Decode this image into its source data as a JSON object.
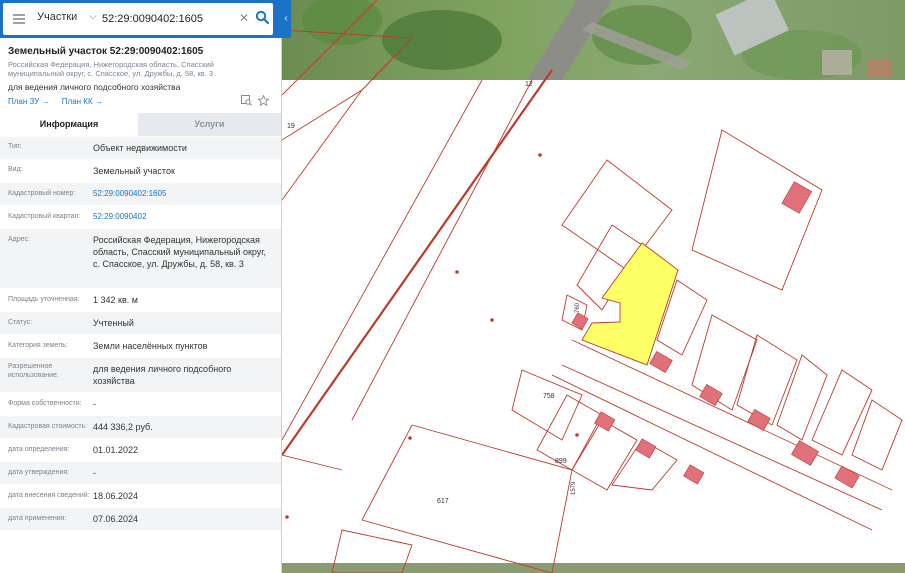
{
  "search": {
    "type_label": "Участки",
    "query": "52:29:0090402:1605"
  },
  "object": {
    "title": "Земельный участок 52:29:0090402:1605",
    "address_short": "Российская Федерация, Нижегородская область, Спасский муниципальный округ, с. Спасское, ул. Дружбы, д. 58, кв. 3",
    "purpose": "для ведения личного подсобного хозяйства",
    "plan_zu": "План ЗУ →",
    "plan_kk": "План КК →"
  },
  "tabs": {
    "info": "Информация",
    "services": "Услуги"
  },
  "rows": [
    {
      "label": "Тип:",
      "value": "Объект недвижимости"
    },
    {
      "label": "Вид:",
      "value": "Земельный участок"
    },
    {
      "label": "Кадастровый номер:",
      "value": "52:29:0090402:1605"
    },
    {
      "label": "Кадастровый квартал:",
      "value": "52:29:0090402"
    },
    {
      "label": "Адрес:",
      "value": "Российская Федерация, Нижегородская область, Спасский муниципальный округ, с. Спасское, ул. Дружбы, д. 58, кв. 3"
    },
    {
      "label": "Площадь уточненная:",
      "value": "1 342 кв. м"
    },
    {
      "label": "Статус:",
      "value": "Учтенный"
    },
    {
      "label": "Категория земель:",
      "value": "Земли населённых пунктов"
    },
    {
      "label": "Разрешенное использование:",
      "value": "для ведения личного подсобного хозяйства"
    },
    {
      "label": "Форма собственности:",
      "value": "-"
    },
    {
      "label": "Кадастровая стоимость:",
      "value": "444 336,2 руб."
    },
    {
      "label": "дата определения:",
      "value": "01.01.2022"
    },
    {
      "label": "дата утверждения:",
      "value": "-"
    },
    {
      "label": "дата внесения сведений:",
      "value": "18.06.2024"
    },
    {
      "label": "дата применения:",
      "value": "07.06.2024"
    }
  ],
  "map_labels": {
    "road": "12",
    "p19": "19",
    "p758": "758",
    "p899": "899",
    "p617": "617",
    "p1579": "1579",
    "p760": "760"
  },
  "colors": {
    "accent": "#1a73c7",
    "parcel_line": "#c0392b",
    "selected_fill": "#ffff66",
    "building_fill": "#e0707a"
  }
}
